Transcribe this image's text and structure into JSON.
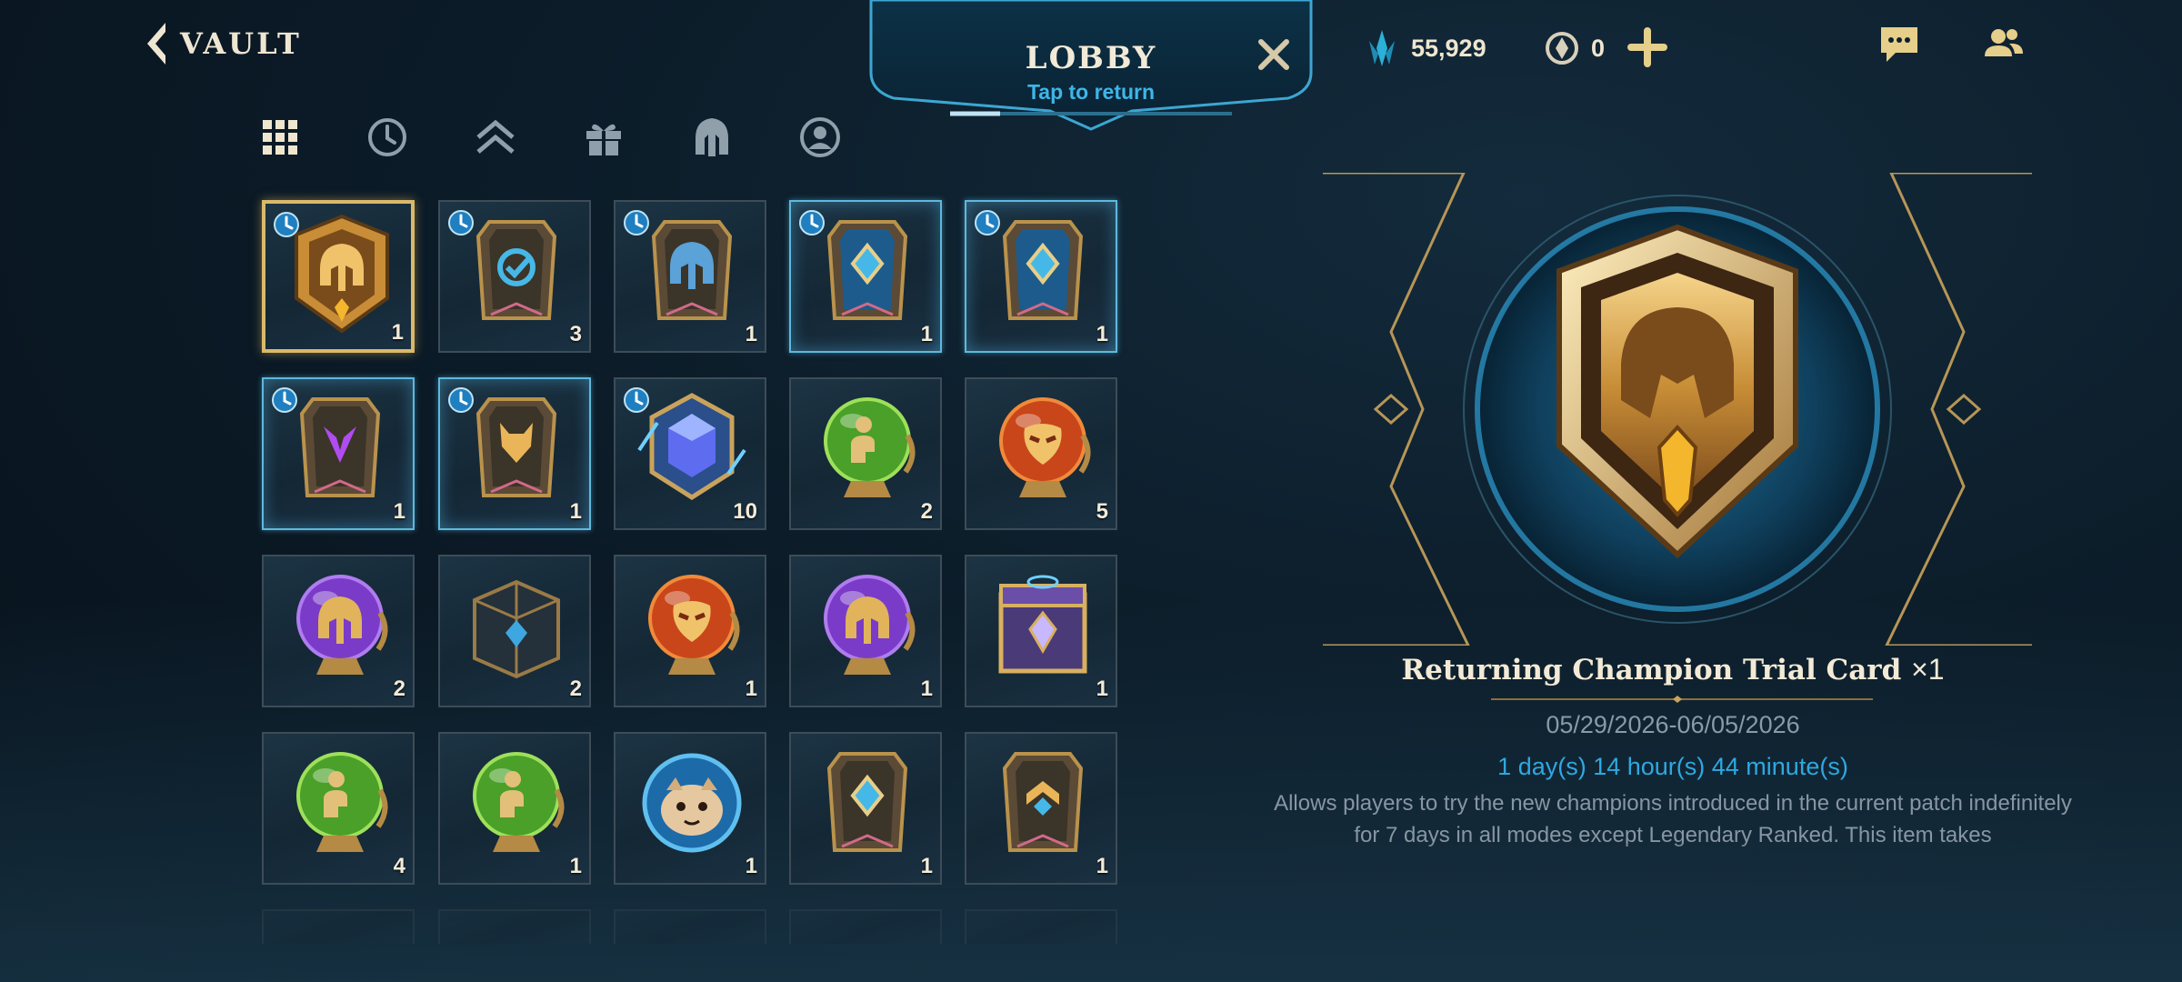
{
  "header": {
    "back_label": "VAULT",
    "lobby_title": "LOBBY",
    "lobby_subtitle": "Tap to return",
    "blue_essence": "55,929",
    "wild_cores": "0"
  },
  "filters": [
    {
      "name": "filter-all-icon",
      "icon": "grid-icon",
      "active": true
    },
    {
      "name": "filter-timed-icon",
      "icon": "clock-icon",
      "active": false
    },
    {
      "name": "filter-upgrade-icon",
      "icon": "double-chevron-up-icon",
      "active": false
    },
    {
      "name": "filter-gift-icon",
      "icon": "gift-icon",
      "active": false
    },
    {
      "name": "filter-champion-icon",
      "icon": "helmet-icon",
      "active": false
    },
    {
      "name": "filter-profile-icon",
      "icon": "profile-icon",
      "active": false
    }
  ],
  "items": [
    {
      "kind": "trial-card-gold-helmet",
      "count": "1",
      "timed": true,
      "selected": true
    },
    {
      "kind": "card-refresh",
      "count": "3",
      "timed": true
    },
    {
      "kind": "card-blue-helmet",
      "count": "1",
      "timed": true
    },
    {
      "kind": "card-blue-gem",
      "count": "1",
      "timed": true,
      "glow": true
    },
    {
      "kind": "card-blue-gem",
      "count": "1",
      "timed": true,
      "glow": true
    },
    {
      "kind": "card-purple-v",
      "count": "1",
      "timed": true,
      "glow": true
    },
    {
      "kind": "card-fox",
      "count": "1",
      "timed": true,
      "glow": true
    },
    {
      "kind": "hex-crystal",
      "count": "10",
      "timed": true
    },
    {
      "kind": "orb-green",
      "count": "2"
    },
    {
      "kind": "orb-red-mask",
      "count": "5"
    },
    {
      "kind": "orb-purple-helmet",
      "count": "2"
    },
    {
      "kind": "chest-dark",
      "count": "2"
    },
    {
      "kind": "orb-red-mask",
      "count": "1"
    },
    {
      "kind": "orb-purple-helmet",
      "count": "1"
    },
    {
      "kind": "chest-ornate",
      "count": "1"
    },
    {
      "kind": "orb-green",
      "count": "4"
    },
    {
      "kind": "orb-green",
      "count": "1"
    },
    {
      "kind": "orb-poro",
      "count": "1"
    },
    {
      "kind": "card-gold-gem",
      "count": "1"
    },
    {
      "kind": "card-gold-chevron",
      "count": "1"
    }
  ],
  "detail": {
    "name": "Returning Champion Trial Card",
    "quantity": "×1",
    "dates": "05/29/2026-06/05/2026",
    "remaining": "1 day(s) 14 hour(s) 44 minute(s)",
    "description": "Allows players to try the new champions introduced in the current patch indefinitely for 7 days in all modes except Legendary Ranked. This item takes"
  },
  "colors": {
    "accent_gold": "#d9b96a",
    "accent_blue": "#3eb6e8",
    "text_cream": "#f2ead7"
  }
}
